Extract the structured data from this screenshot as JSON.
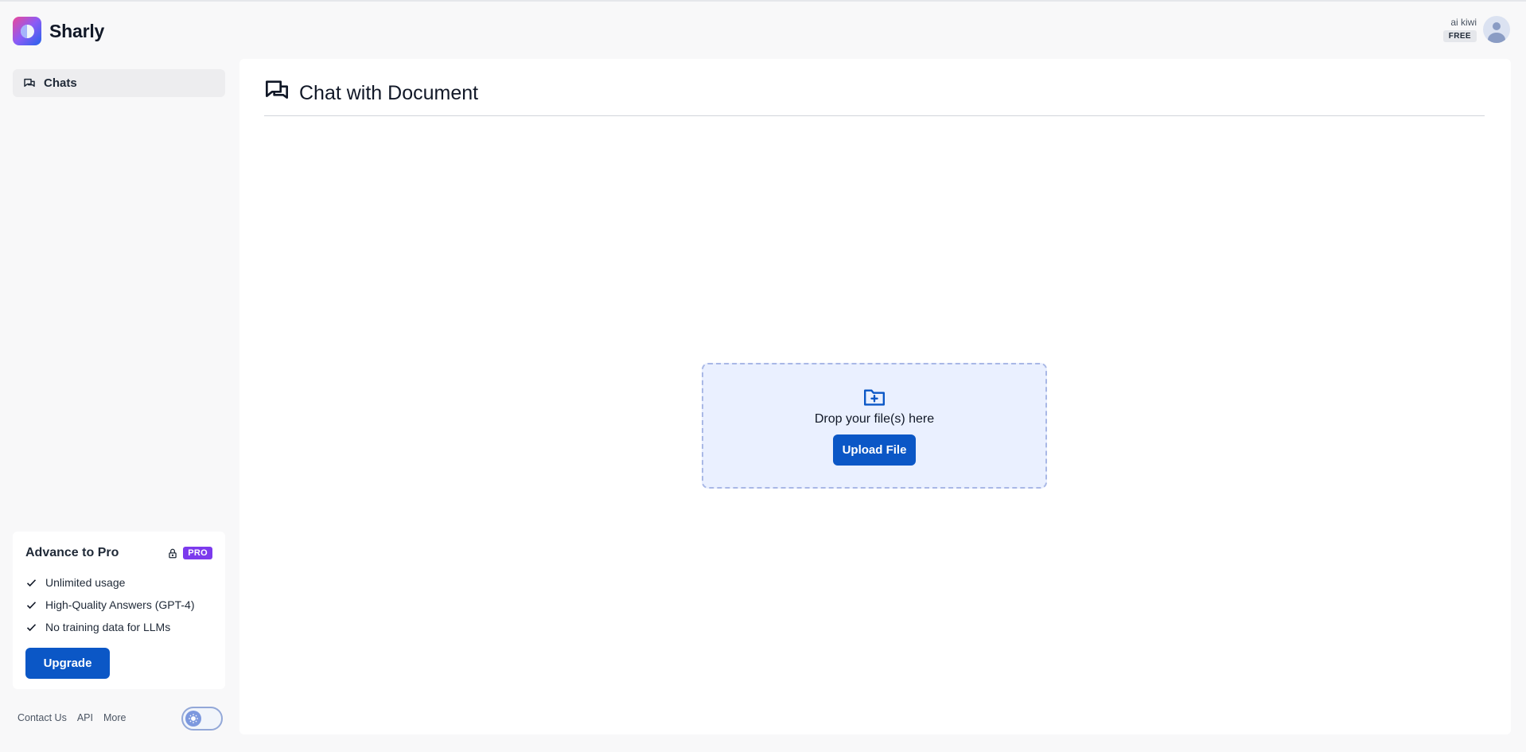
{
  "app": {
    "name": "Sharly",
    "logo_icon": "sharly-logo-icon"
  },
  "user": {
    "name": "ai kiwi",
    "plan": "FREE",
    "avatar_icon": "user-avatar-icon"
  },
  "sidebar": {
    "items": [
      {
        "label": "Chats",
        "icon": "chat-bubbles-icon",
        "active": true
      }
    ]
  },
  "pro_card": {
    "title": "Advance to Pro",
    "badge": "PRO",
    "lock_icon": "lock-icon",
    "features": [
      "Unlimited usage",
      "High-Quality Answers (GPT-4)",
      "No training data for LLMs"
    ],
    "upgrade_label": "Upgrade"
  },
  "footer": {
    "links": [
      "Contact Us",
      "API",
      "More"
    ],
    "theme_toggle_icon": "sun-icon"
  },
  "main": {
    "title": "Chat with Document",
    "title_icon": "chat-bubbles-icon",
    "dropzone": {
      "icon": "folder-plus-icon",
      "text": "Drop your file(s) here",
      "button_label": "Upload File"
    }
  },
  "colors": {
    "primary": "#0b57c6",
    "pro_badge": "#7c3aed",
    "dropzone_bg": "#eaf0ff",
    "dropzone_border": "#a9b8e6",
    "page_bg": "#f8f8f9"
  }
}
